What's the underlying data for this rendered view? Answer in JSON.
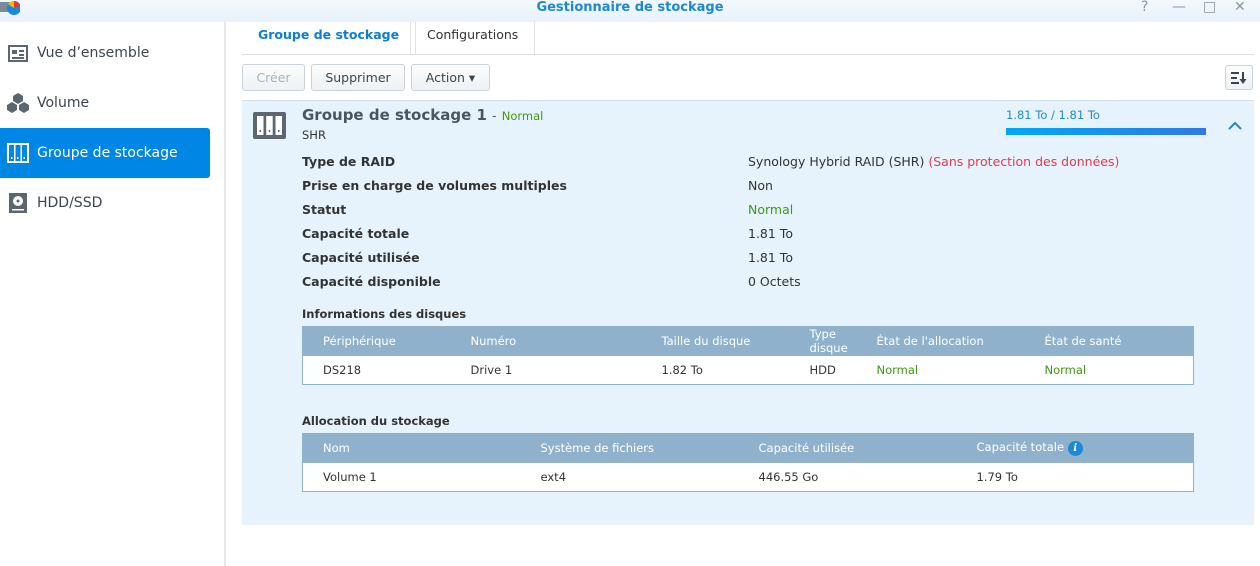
{
  "window": {
    "title": "Gestionnaire de stockage",
    "help": "?",
    "minimize": "—",
    "maximize": "□",
    "close": "✕"
  },
  "sidebar": {
    "items": [
      {
        "label": "Vue d’ensemble",
        "icon": "overview-icon"
      },
      {
        "label": "Volume",
        "icon": "cubes-icon"
      },
      {
        "label": "Groupe de stockage",
        "icon": "storage-pool-icon",
        "active": true
      },
      {
        "label": "HDD/SSD",
        "icon": "hdd-icon"
      }
    ]
  },
  "tabs": [
    {
      "label": "Groupe de stockage",
      "active": true
    },
    {
      "label": "Configurations"
    }
  ],
  "toolbar": {
    "create": "Créer",
    "delete": "Supprimer",
    "action": "Action ▾",
    "sort_icon": "sort-icon"
  },
  "pool": {
    "name": "Groupe de stockage 1",
    "separator": "-",
    "status": "Normal",
    "type": "SHR",
    "usage_text": "1.81 To / 1.81 To",
    "usage_fraction": 1.0,
    "details": [
      {
        "label": "Type de RAID",
        "value": "Synology Hybrid RAID (SHR)",
        "warning": "(Sans protection des données)"
      },
      {
        "label": "Prise en charge de volumes multiples",
        "value": "Non"
      },
      {
        "label": "Statut",
        "value": "Normal"
      },
      {
        "label": "Capacité totale",
        "value": "1.81 To"
      },
      {
        "label": "Capacité utilisée",
        "value": "1.81 To"
      },
      {
        "label": "Capacité disponible",
        "value": "0 Octets"
      }
    ]
  },
  "disks": {
    "title": "Informations des disques",
    "headers": [
      "Périphérique",
      "Numéro",
      "Taille du disque",
      "Type disque",
      "État de l'allocation",
      "État de santé"
    ],
    "rows": [
      [
        "DS218",
        "Drive 1",
        "1.82 To",
        "HDD",
        "Normal",
        "Normal"
      ]
    ]
  },
  "allocation": {
    "title": "Allocation du stockage",
    "headers": [
      "Nom",
      "Système de fichiers",
      "Capacité utilisée",
      "Capacité totale"
    ],
    "rows": [
      [
        "Volume 1",
        "ext4",
        "446.55 Go",
        "1.79 To"
      ]
    ]
  },
  "colors": {
    "accent": "#0086e5",
    "normal": "#3b9a0f",
    "warning": "#e6394d",
    "table_header": "#8fb1cc",
    "panel": "#e6f3fd"
  }
}
